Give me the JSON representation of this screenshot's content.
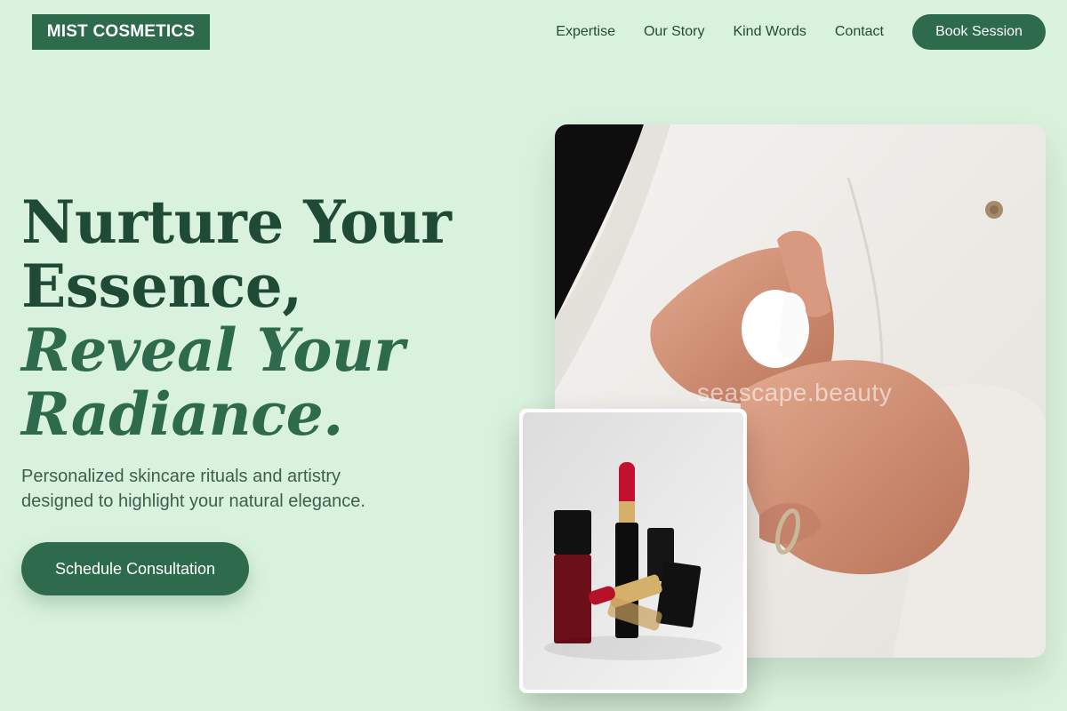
{
  "brand": {
    "name": "MIST COSMETICS"
  },
  "nav": {
    "links": [
      "Expertise",
      "Our Story",
      "Kind Words",
      "Contact"
    ],
    "cta": "Book Session"
  },
  "hero": {
    "headline_line1": "Nurture Your",
    "headline_line2": "Essence,",
    "headline_italic_line1": "Reveal Your",
    "headline_italic_line2": "Radiance.",
    "subtext": "Personalized skincare rituals and artistry designed to highlight your natural elegance.",
    "cta": "Schedule Consultation",
    "image_watermark": "seascape.beauty"
  },
  "colors": {
    "background": "#d9f2dd",
    "accent": "#2e6a4c",
    "headline": "#1f4a36",
    "body_text": "#3f5d4c"
  }
}
